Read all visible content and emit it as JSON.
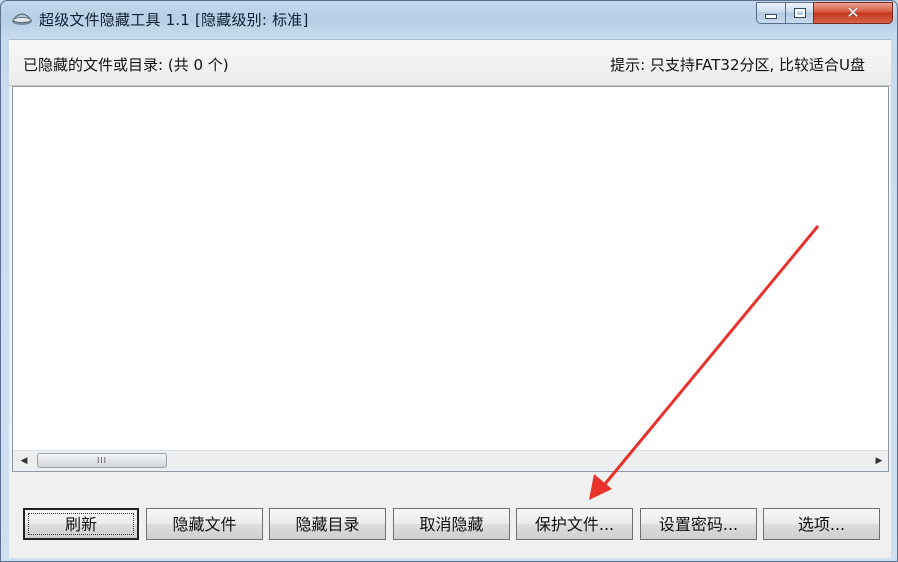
{
  "window": {
    "title": "超级文件隐藏工具 1.1  [隐藏级别: 标准]",
    "close_glyph": "✕"
  },
  "info_bar": {
    "hidden_list_label": "已隐藏的文件或目录: (共 0 个)",
    "hint": "提示: 只支持FAT32分区, 比较适合U盘"
  },
  "list": {
    "items": []
  },
  "scrollbar": {
    "left_arrow": "◀",
    "right_arrow": "▶",
    "grip": "III"
  },
  "buttons": {
    "refresh": "刷新",
    "hide_file": "隐藏文件",
    "hide_dir": "隐藏目录",
    "unhide": "取消隐藏",
    "protect_file": "保护文件...",
    "set_password": "设置密码...",
    "options": "选项..."
  },
  "colors": {
    "annotation_arrow": "#e8322c",
    "close_button": "#c9432b"
  },
  "annotation": {
    "target": "protect_file"
  }
}
